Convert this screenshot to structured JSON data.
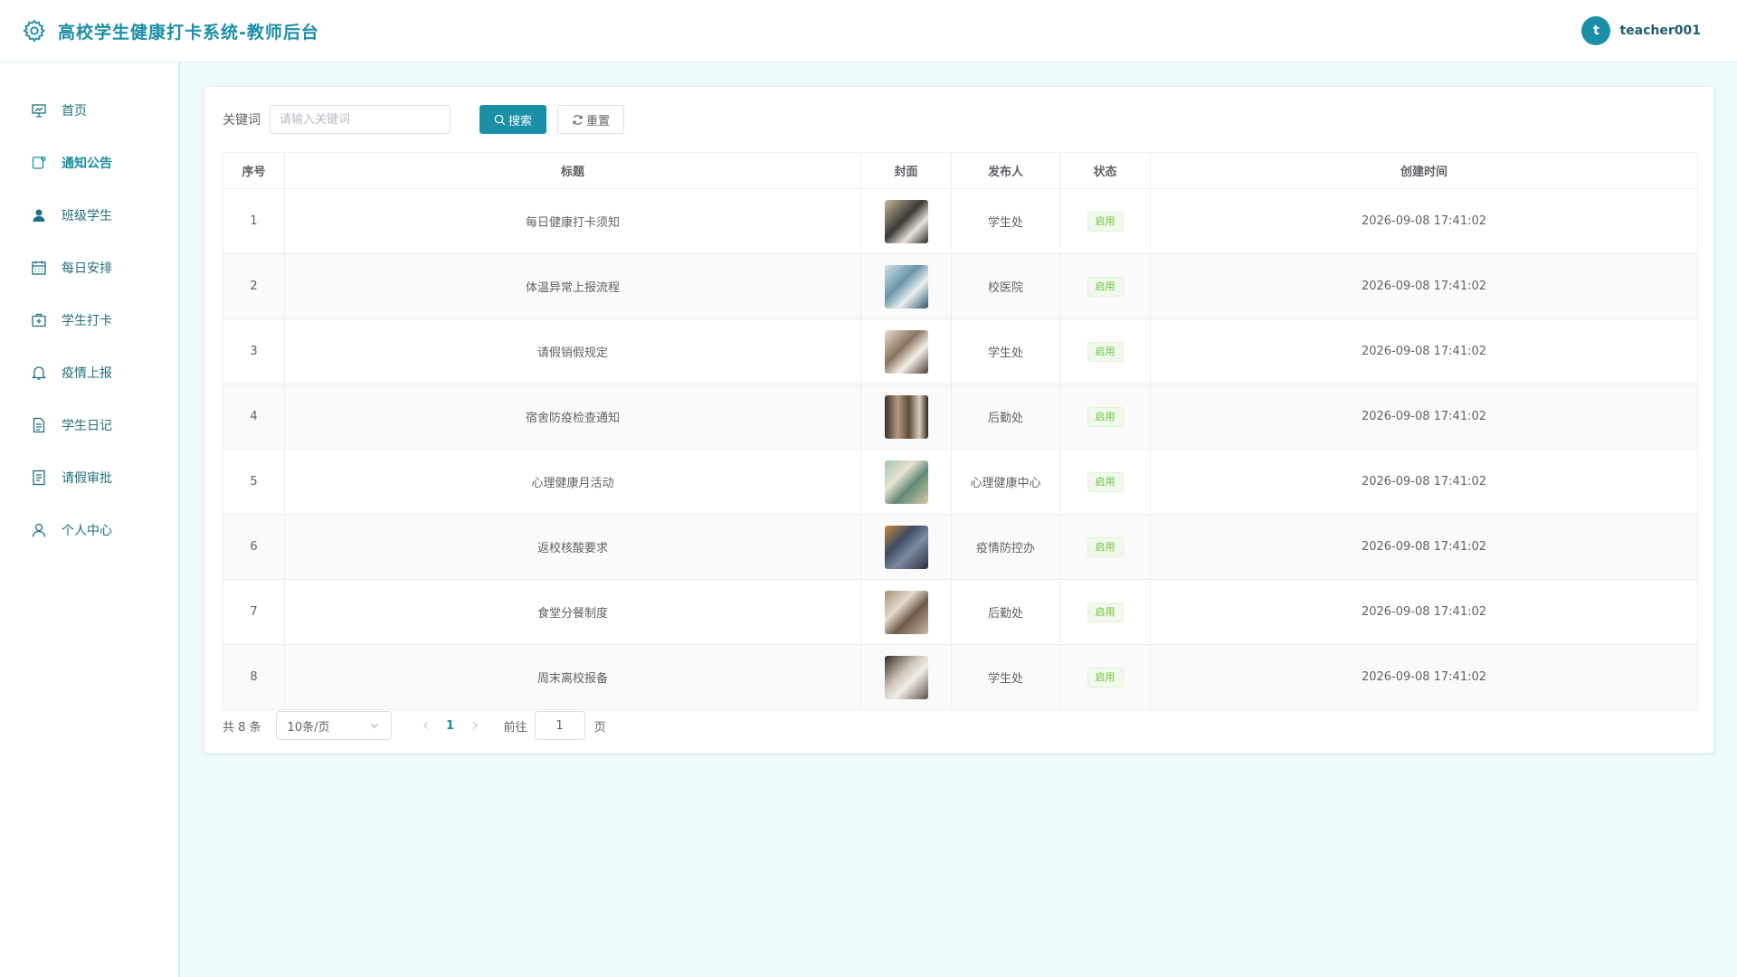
{
  "header": {
    "title": "高校学生健康打卡系统-教师后台",
    "avatar_initial": "t",
    "username": "teacher001"
  },
  "sidebar": {
    "items": [
      {
        "label": "首页",
        "icon": "dashboard-icon"
      },
      {
        "label": "通知公告",
        "icon": "notice-icon"
      },
      {
        "label": "班级学生",
        "icon": "user-filled-icon"
      },
      {
        "label": "每日安排",
        "icon": "calendar-icon"
      },
      {
        "label": "学生打卡",
        "icon": "first-aid-kit-icon"
      },
      {
        "label": "疫情上报",
        "icon": "bell-icon"
      },
      {
        "label": "学生日记",
        "icon": "document-icon"
      },
      {
        "label": "请假审批",
        "icon": "tickets-icon"
      },
      {
        "label": "个人中心",
        "icon": "user-icon"
      }
    ],
    "active_index": 1
  },
  "search": {
    "keyword_label": "关键词",
    "placeholder": "请输入关键词",
    "search_label": "搜索",
    "reset_label": "重置"
  },
  "table": {
    "columns": [
      "序号",
      "标题",
      "封面",
      "发布人",
      "状态",
      "创建时间"
    ],
    "rows": [
      {
        "index": "1",
        "title": "每日健康打卡须知",
        "publisher": "学生处",
        "status": "启用",
        "created": "2026-09-08 17:41:02"
      },
      {
        "index": "2",
        "title": "体温异常上报流程",
        "publisher": "校医院",
        "status": "启用",
        "created": "2026-09-08 17:41:02"
      },
      {
        "index": "3",
        "title": "请假销假规定",
        "publisher": "学生处",
        "status": "启用",
        "created": "2026-09-08 17:41:02"
      },
      {
        "index": "4",
        "title": "宿舍防疫检查通知",
        "publisher": "后勤处",
        "status": "启用",
        "created": "2026-09-08 17:41:02"
      },
      {
        "index": "5",
        "title": "心理健康月活动",
        "publisher": "心理健康中心",
        "status": "启用",
        "created": "2026-09-08 17:41:02"
      },
      {
        "index": "6",
        "title": "返校核酸要求",
        "publisher": "疫情防控办",
        "status": "启用",
        "created": "2026-09-08 17:41:02"
      },
      {
        "index": "7",
        "title": "食堂分餐制度",
        "publisher": "后勤处",
        "status": "启用",
        "created": "2026-09-08 17:41:02"
      },
      {
        "index": "8",
        "title": "周末离校报备",
        "publisher": "学生处",
        "status": "启用",
        "created": "2026-09-08 17:41:02"
      }
    ]
  },
  "pagination": {
    "total_text": "共 8 条",
    "page_size": "10条/页",
    "current_page": "1",
    "goto_label": "前往",
    "goto_value": "1",
    "goto_suffix": "页"
  },
  "colors": {
    "accent": "#1a8fa8",
    "background": "#eefbfc",
    "status_ok": "#67c23a"
  }
}
